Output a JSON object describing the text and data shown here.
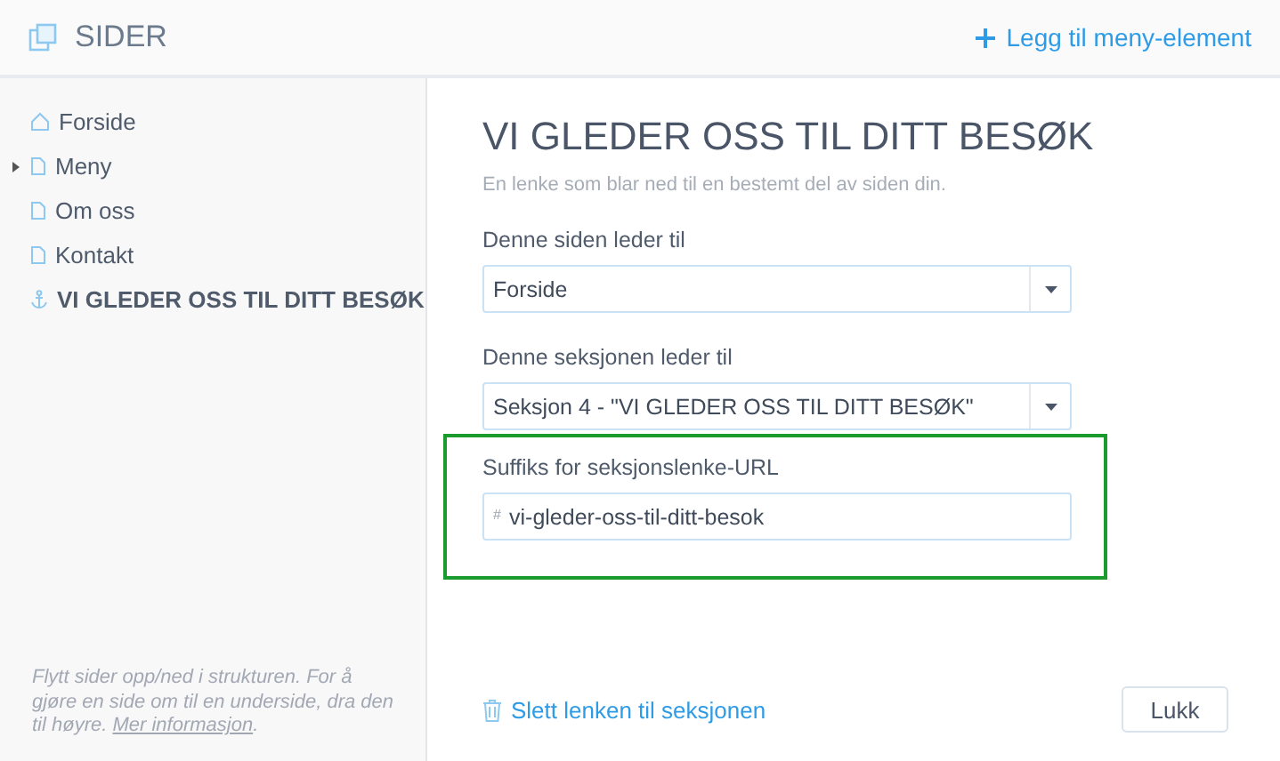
{
  "header": {
    "title": "SIDER",
    "add_button": "Legg til meny-element"
  },
  "sidebar": {
    "items": [
      {
        "label": "Forside",
        "kind": "home",
        "expandable": false,
        "selected": false
      },
      {
        "label": "Meny",
        "kind": "page",
        "expandable": true,
        "selected": false
      },
      {
        "label": "Om oss",
        "kind": "page",
        "expandable": false,
        "selected": false
      },
      {
        "label": "Kontakt",
        "kind": "page",
        "expandable": false,
        "selected": false
      },
      {
        "label": "VI GLEDER OSS TIL DITT BESØK",
        "kind": "anchor",
        "expandable": false,
        "selected": true
      }
    ],
    "help": {
      "text": "Flytt sider opp/ned i strukturen. For å gjøre en side om til en underside, dra den til høyre. ",
      "link": "Mer informasjon",
      "after": "."
    }
  },
  "panel": {
    "title": "VI GLEDER OSS TIL DITT BESØK",
    "subtitle": "En lenke som blar ned til en bestemt del av siden din.",
    "fields": [
      {
        "kind": "select",
        "label": "Denne siden leder til",
        "value": "Forside",
        "highlighted": false
      },
      {
        "kind": "select",
        "label": "Denne seksjonen leder til",
        "value": "Seksjon 4 - \"VI GLEDER OSS TIL DITT BESØK\"",
        "highlighted": false
      },
      {
        "kind": "text",
        "label": "Suffiks for seksjonslenke-URL",
        "prefix": "#",
        "value": "vi-gleder-oss-til-ditt-besok",
        "highlighted": true
      }
    ],
    "delete_link": "Slett lenken til seksjonen",
    "close_button": "Lukk"
  }
}
